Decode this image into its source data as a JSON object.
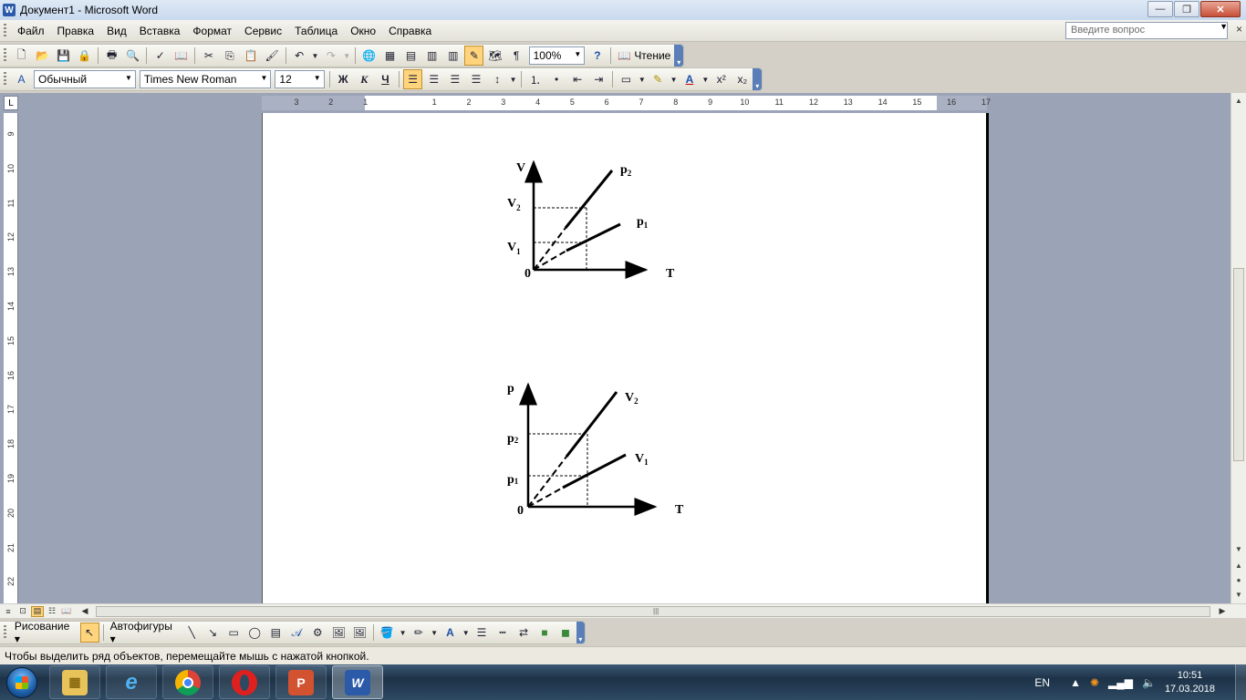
{
  "window": {
    "title": "Документ1 - Microsoft Word",
    "app_icon_letter": "W",
    "minimize": "—",
    "restore": "❐",
    "close": "✕"
  },
  "menu": {
    "items": [
      "Файл",
      "Правка",
      "Вид",
      "Вставка",
      "Формат",
      "Сервис",
      "Таблица",
      "Окно",
      "Справка"
    ],
    "help_placeholder": "Введите вопрос",
    "close_doc": "×"
  },
  "standard_toolbar": {
    "zoom": "100%",
    "reading_label": "Чтение",
    "pilcrow": "¶"
  },
  "format_toolbar": {
    "style": "Обычный",
    "font": "Times New Roman",
    "size": "12",
    "bold": "Ж",
    "italic": "К",
    "underline": "Ч",
    "superscript": "x²",
    "subscript": "x₂"
  },
  "ruler": {
    "h_numbers": [
      "3",
      "2",
      "1",
      "",
      "1",
      "2",
      "3",
      "4",
      "5",
      "6",
      "7",
      "8",
      "9",
      "10",
      "11",
      "12",
      "13",
      "14",
      "15",
      "16",
      "17"
    ],
    "v_numbers": [
      "9",
      "10",
      "11",
      "12",
      "13",
      "14",
      "15",
      "16",
      "17",
      "18",
      "19",
      "20",
      "21",
      "22"
    ]
  },
  "diagram1": {
    "y_axis": "V",
    "x_axis": "T",
    "origin": "0",
    "line_upper": "p",
    "line_upper_sub": "2",
    "line_lower": "p",
    "line_lower_sub": "1",
    "tick_upper": "V",
    "tick_upper_sub": "2",
    "tick_lower": "V",
    "tick_lower_sub": "1"
  },
  "diagram2": {
    "y_axis": "p",
    "x_axis": "T",
    "origin": "0",
    "line_upper": "V",
    "line_upper_sub": "2",
    "line_lower": "V",
    "line_lower_sub": "1",
    "tick_upper": "p",
    "tick_upper_sub": "2",
    "tick_lower": "p",
    "tick_lower_sub": "1"
  },
  "drawing_toolbar": {
    "drawing_label": "Рисование ▾",
    "autoshapes_label": "Автофигуры ▾"
  },
  "status_bar": {
    "text": "Чтобы выделить ряд объектов, перемещайте мышь с нажатой кнопкой."
  },
  "taskbar": {
    "lang": "EN",
    "time": "10:51",
    "date": "17.03.2018"
  }
}
